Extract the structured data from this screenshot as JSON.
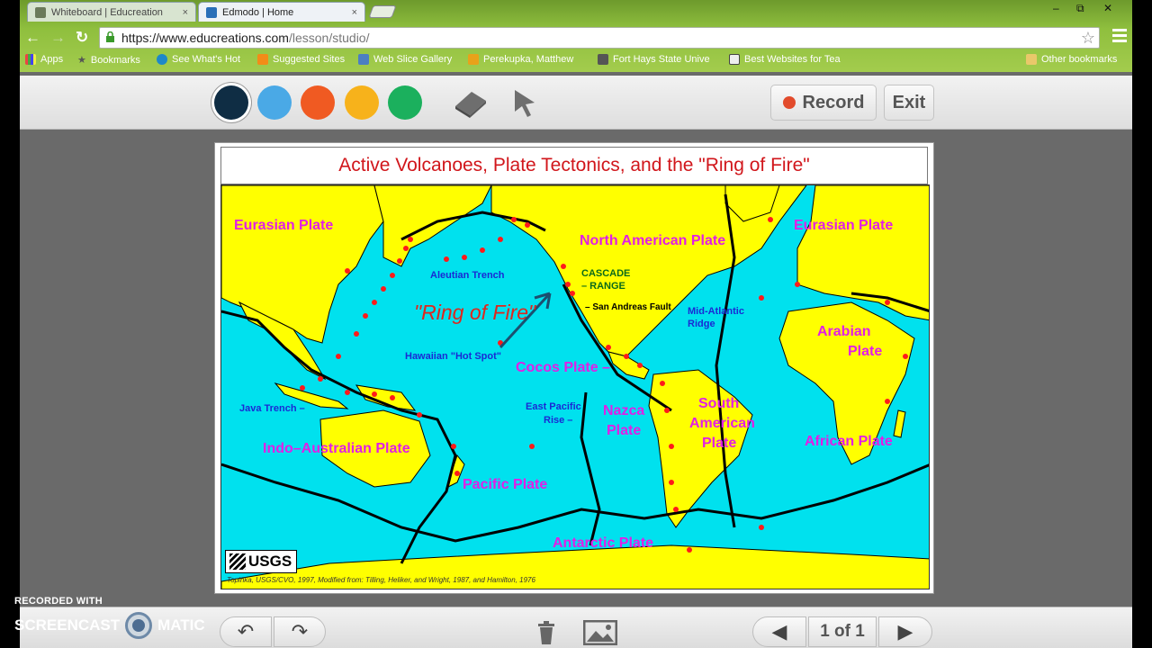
{
  "browser": {
    "tabs": [
      {
        "title": "Whiteboard | Educreation",
        "close": "×"
      },
      {
        "title": "Edmodo | Home",
        "close": "×"
      }
    ],
    "url_host": "https://www.educreations.com",
    "url_path": "/lesson/studio/",
    "bookmarks": [
      "Apps",
      "Bookmarks",
      "See What's Hot",
      "Suggested Sites",
      "Web Slice Gallery",
      "Perekupka, Matthew",
      "Fort Hays State Unive",
      "Best Websites for Tea",
      "Other bookmarks"
    ]
  },
  "editor": {
    "colors": [
      "#0f2d44",
      "#4aa9e6",
      "#f05a22",
      "#f7b21b",
      "#1bb05d"
    ],
    "tools": [
      "eraser-icon",
      "pointer-icon"
    ],
    "record_label": "Record",
    "exit_label": "Exit"
  },
  "map": {
    "title": "Active Volcanoes, Plate Tectonics, and the \"Ring of Fire\"",
    "labels": {
      "eurasian_left": "Eurasian Plate",
      "eurasian_right": "Eurasian Plate",
      "north_american": "North American Plate",
      "aleutian": "Aleutian Trench",
      "ring": "\"Ring of Fire\"",
      "cascade1": "CASCADE",
      "cascade2": "– RANGE",
      "san_andreas": "– San Andreas Fault",
      "mid_atlantic1": "Mid-Atlantic",
      "mid_atlantic2": "Ridge",
      "hawaiian": "Hawaiian \"Hot Spot\"",
      "cocos": "Cocos Plate –",
      "arabian1": "Arabian",
      "arabian2": "Plate",
      "java": "Java Trench –",
      "indo_australian": "Indo–Australian Plate",
      "east_pacific1": "East Pacific",
      "east_pacific2": "Rise –",
      "nazca1": "Nazca",
      "nazca2": "Plate",
      "south_american1": "South",
      "south_american2": "American",
      "south_american3": "Plate",
      "african": "African Plate",
      "pacific": "Pacific Plate",
      "antarctic": "Antarctic Plate"
    },
    "logo": "USGS",
    "credit": "Topinka, USGS/CVO, 1997, Modified from: Tilling, Heliker, and Wright, 1987, and Hamilton, 1976"
  },
  "bottom": {
    "page_indicator": "1 of 1"
  },
  "watermark": {
    "line1": "RECORDED WITH",
    "line2a": "SCREENCAST",
    "line2b": "MATIC"
  }
}
